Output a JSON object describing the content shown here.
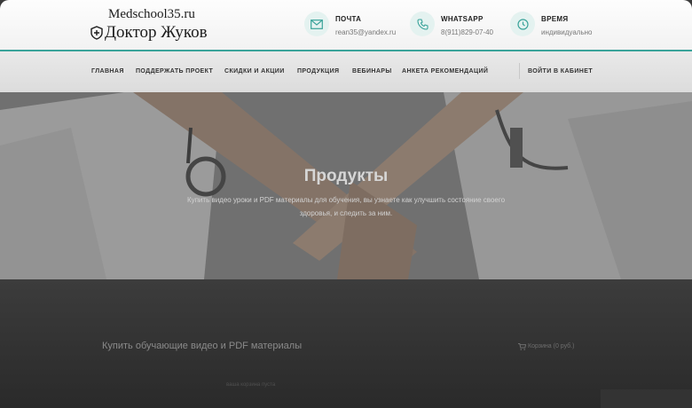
{
  "header": {
    "logo_top": "Medschool35.ru",
    "logo_bottom": "Доктор Жуков",
    "contacts": [
      {
        "title": "ПОЧТА",
        "value": "rean35@yandex.ru",
        "icon": "envelope-icon"
      },
      {
        "title": "WHATSAPP",
        "value": "8(911)829-07-40",
        "icon": "phone-icon"
      },
      {
        "title": "ВРЕМЯ",
        "value": "индивидуально",
        "icon": "clock-icon"
      }
    ],
    "accent_color": "#3aa39a"
  },
  "nav": {
    "items": [
      "ГЛАВНАЯ",
      "ПОДДЕРЖАТЬ ПРОЕКТ",
      "СКИДКИ И АКЦИИ",
      "ПРОДУКЦИЯ",
      "ВЕБИНАРЫ",
      "АНКЕТА РЕКОМЕНДАЦИЙ"
    ],
    "login": "ВОЙТИ В КАБИНЕТ"
  },
  "hero": {
    "title": "Продукты",
    "subtitle": "Купить видео уроки и PDF материалы для обучения, вы узнаете как улучшить состояние своего здоровья, и следить за ним."
  },
  "content": {
    "title": "Купить обучающие видео и PDF материалы",
    "cart": "Корзина (0 руб.)",
    "cart_icon": "cart-icon",
    "faint": "ваша корзина пуста"
  }
}
